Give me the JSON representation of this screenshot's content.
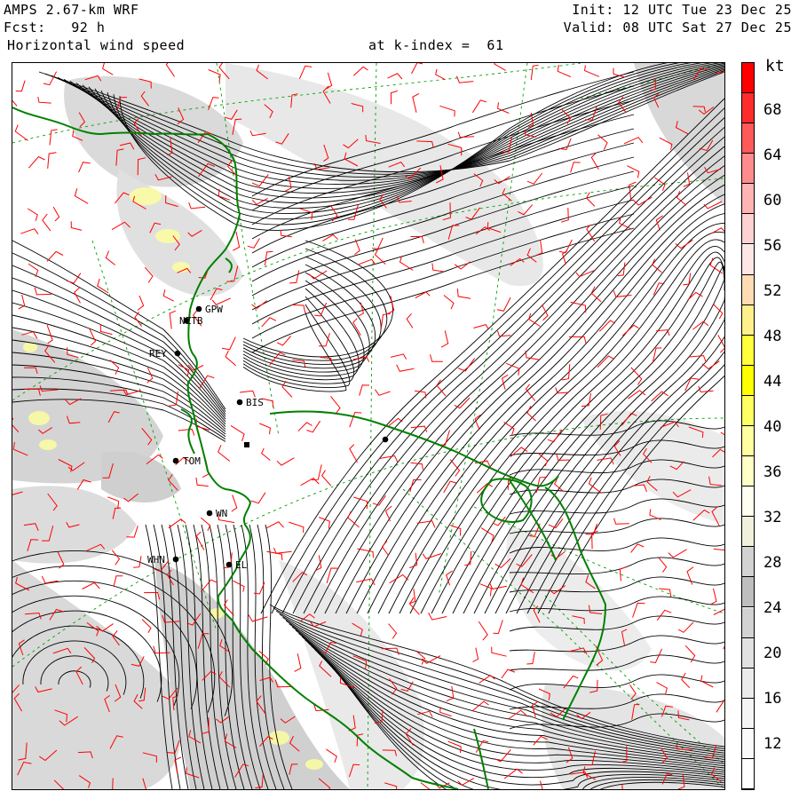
{
  "header": {
    "model": "AMPS 2.67-km WRF",
    "forecast": "Fcst:   92 h",
    "field": "Horizontal wind speed",
    "level": "at k-index =  61",
    "init": "Init: 12 UTC Tue 23 Dec 25",
    "valid": "Valid: 08 UTC Sat 27 Dec 25"
  },
  "colorbar": {
    "unit": "kt",
    "labels": [
      "68",
      "64",
      "60",
      "56",
      "52",
      "48",
      "44",
      "40",
      "36",
      "32",
      "28",
      "24",
      "20",
      "16",
      "12"
    ],
    "colors": [
      "#ff0000",
      "#ff2c2c",
      "#ff5a5a",
      "#ff8c8c",
      "#ffb4b4",
      "#ffd2d2",
      "#ffe6e6",
      "#ffdcb4",
      "#fff08c",
      "#ffff3c",
      "#ffff00",
      "#ffff64",
      "#ffffa0",
      "#ffffc8",
      "#fffff0",
      "#f0f0dc",
      "#d2d2d2",
      "#bebebe",
      "#d2d2d2",
      "#e1e1e1",
      "#ebebeb",
      "#f5f5f5",
      "#fafafa",
      "#ffffff"
    ]
  },
  "stations": [
    {
      "code": "GPW",
      "marker": "dot"
    },
    {
      "code": "NZTB",
      "marker": "dot"
    },
    {
      "code": "REY",
      "marker": "dot"
    },
    {
      "code": "BIS",
      "marker": "dot"
    },
    {
      "code": "",
      "marker": "square"
    },
    {
      "code": "TOM",
      "marker": "dot"
    },
    {
      "code": "WN",
      "marker": "dot"
    },
    {
      "code": "WHN",
      "marker": "dot"
    },
    {
      "code": "EL",
      "marker": "dot"
    },
    {
      "code": "",
      "marker": "dot"
    }
  ],
  "colors": {
    "coastline": "#008000",
    "graticule": "#00a000",
    "barbs": "#ff0000",
    "streamlines": "#000000"
  }
}
